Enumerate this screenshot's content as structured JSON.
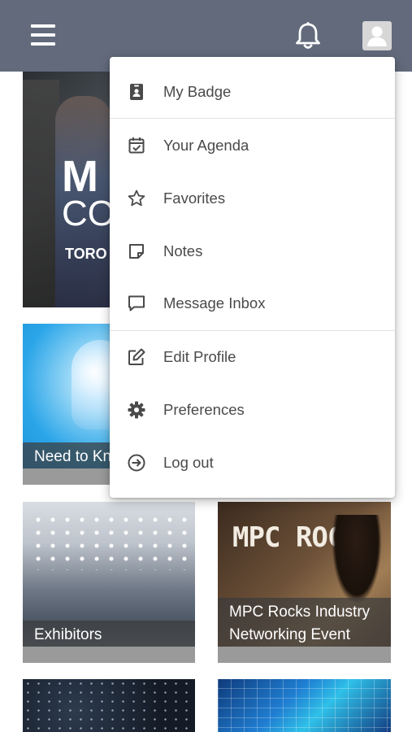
{
  "header": {
    "menu_icon": "hamburger-icon",
    "notifications_icon": "bell-icon",
    "profile_icon": "user-avatar-icon",
    "background_color": "#626a7c"
  },
  "tiles": {
    "hero": {
      "text_line1": "M",
      "text_line2": "CO",
      "text_line3": "TORO"
    },
    "need_to_know": {
      "caption": "Need to Know"
    },
    "exhibitors": {
      "caption": "Exhibitors"
    },
    "mpc_rocks": {
      "image_text": "MPC ROCKS",
      "caption": "MPC Rocks Industry Networking Event"
    }
  },
  "menu": {
    "items": [
      {
        "label": "My Badge",
        "icon": "badge-icon"
      },
      {
        "label": "Your Agenda",
        "icon": "calendar-check-icon"
      },
      {
        "label": "Favorites",
        "icon": "star-icon"
      },
      {
        "label": "Notes",
        "icon": "note-icon"
      },
      {
        "label": "Message Inbox",
        "icon": "message-icon"
      },
      {
        "label": "Edit Profile",
        "icon": "edit-icon"
      },
      {
        "label": "Preferences",
        "icon": "gear-icon"
      },
      {
        "label": "Log out",
        "icon": "logout-icon"
      }
    ]
  }
}
